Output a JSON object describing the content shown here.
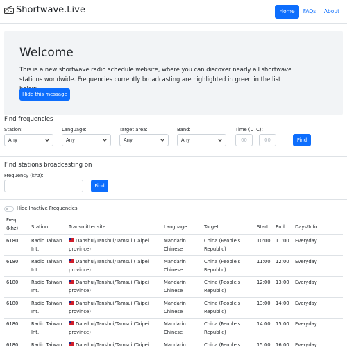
{
  "navbar": {
    "brand": "Shortwave.Live",
    "brand_icon": "radio-icon",
    "links": [
      "Home",
      "FAQs",
      "About"
    ],
    "active": "Home"
  },
  "welcome": {
    "title": "Welcome",
    "text": "This is a new shortwave radio schedule website, where you can discover nearly all shortwave stations worldwide. Frequencies currently broadcasting are highlighted in green in the list below.",
    "hide_button": "Hide this message"
  },
  "find_frequencies": {
    "title": "Find frequencies",
    "station": {
      "label": "Station:",
      "value": "Any"
    },
    "language": {
      "label": "Language:",
      "value": "Any"
    },
    "target": {
      "label": "Target area:",
      "value": "Any"
    },
    "band": {
      "label": "Band:",
      "value": "Any"
    },
    "time": {
      "label": "Time (UTC):",
      "hour_placeholder": "00",
      "minute_placeholder": "00"
    },
    "find_button": "Find"
  },
  "find_stations": {
    "title": "Find stations broadcasting on",
    "freq_label": "Frequency (khz):",
    "find_button": "Find"
  },
  "toggle": {
    "label": "Hide Inactive Frequencies"
  },
  "table": {
    "headers": {
      "freq1": "Freq",
      "freq2": "(khz)",
      "station": "Station",
      "site": "Transmitter site",
      "language": "Language",
      "target": "Target",
      "start": "Start",
      "end": "End",
      "days": "Days/Info"
    },
    "rows": [
      {
        "freq": "6180",
        "station1": "Radio Taiwan",
        "station2": "Int.",
        "site1": "Danshui/Tanshui/Tamsui (Taipei",
        "site2": "province)",
        "lang1": "Mandarin",
        "lang2": "Chinese",
        "target1": "China (People's",
        "target2": "Republic)",
        "start": "10:00",
        "end": "11:00",
        "days": "Everyday"
      },
      {
        "freq": "6180",
        "station1": "Radio Taiwan",
        "station2": "Int.",
        "site1": "Danshui/Tanshui/Tamsui (Taipei",
        "site2": "province)",
        "lang1": "Mandarin",
        "lang2": "Chinese",
        "target1": "China (People's",
        "target2": "Republic)",
        "start": "11:00",
        "end": "12:00",
        "days": "Everyday"
      },
      {
        "freq": "6180",
        "station1": "Radio Taiwan",
        "station2": "Int.",
        "site1": "Danshui/Tanshui/Tamsui (Taipei",
        "site2": "province)",
        "lang1": "Mandarin",
        "lang2": "Chinese",
        "target1": "China (People's",
        "target2": "Republic)",
        "start": "12:00",
        "end": "13:00",
        "days": "Everyday"
      },
      {
        "freq": "6180",
        "station1": "Radio Taiwan",
        "station2": "Int.",
        "site1": "Danshui/Tanshui/Tamsui (Taipei",
        "site2": "province)",
        "lang1": "Mandarin",
        "lang2": "Chinese",
        "target1": "China (People's",
        "target2": "Republic)",
        "start": "13:00",
        "end": "14:00",
        "days": "Everyday"
      },
      {
        "freq": "6180",
        "station1": "Radio Taiwan",
        "station2": "Int.",
        "site1": "Danshui/Tanshui/Tamsui (Taipei",
        "site2": "province)",
        "lang1": "Mandarin",
        "lang2": "Chinese",
        "target1": "China (People's",
        "target2": "Republic)",
        "start": "14:00",
        "end": "15:00",
        "days": "Everyday"
      },
      {
        "freq": "6180",
        "station1": "Radio Taiwan",
        "station2": "Int.",
        "site1": "Danshui/Tanshui/Tamsui (Taipei",
        "site2": "province)",
        "lang1": "Mandarin",
        "lang2": "Chinese",
        "target1": "China (People's",
        "target2": "Republic)",
        "start": "15:00",
        "end": "16:00",
        "days": "Everyday"
      }
    ],
    "flag_icon": "taiwan-flag-icon"
  },
  "colors": {
    "primary": "#0d6efd",
    "jumbotron_bg": "#f2f4f6",
    "border": "#dee2e6"
  }
}
